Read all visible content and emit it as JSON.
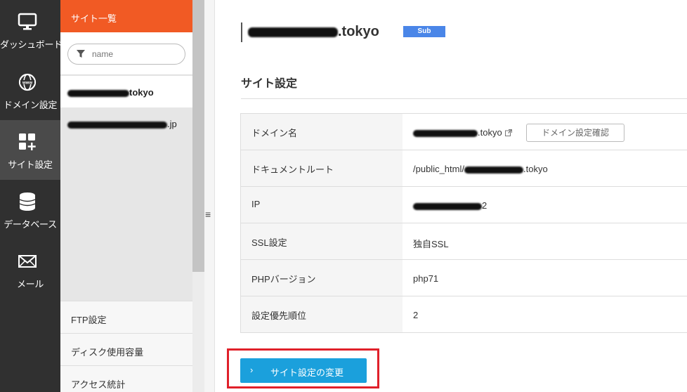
{
  "nav": {
    "items": [
      {
        "label": "ダッシュボード",
        "icon": "monitor-icon"
      },
      {
        "label": "ドメイン設定",
        "icon": "globe-icon"
      },
      {
        "label": "サイト設定",
        "icon": "grid-plus-icon",
        "active": true
      },
      {
        "label": "データベース",
        "icon": "database-icon"
      },
      {
        "label": "メール",
        "icon": "envelope-icon"
      }
    ]
  },
  "site_panel": {
    "header": "サイト一覧",
    "search_placeholder": "name",
    "sites": [
      {
        "visible_text": "tokyo",
        "selected": true
      },
      {
        "visible_text": ".jp",
        "selected": false
      }
    ],
    "lower_links": [
      "FTP設定",
      "ディスク使用容量",
      "アクセス統計"
    ]
  },
  "main": {
    "title_suffix": ".tokyo",
    "badge": "Sub",
    "section_title": "サイト設定",
    "rows": [
      {
        "key": "ドメイン名",
        "value": ".tokyo",
        "button": "ドメイン設定確認"
      },
      {
        "key": "ドキュメントルート",
        "value_prefix": "/public_html/",
        "value_suffix": ".tokyo"
      },
      {
        "key": "IP",
        "value": "2"
      },
      {
        "key": "SSL設定",
        "value": "独自SSL"
      },
      {
        "key": "PHPバージョン",
        "value": "php71"
      },
      {
        "key": "設定優先順位",
        "value": "2"
      }
    ],
    "change_button": "サイト設定の変更"
  },
  "colors": {
    "accent_orange": "#f15a24",
    "nav_dark": "#303030",
    "button_blue": "#1ba0dc",
    "badge_blue": "#4a86e8",
    "highlight_red": "#e0202a"
  }
}
